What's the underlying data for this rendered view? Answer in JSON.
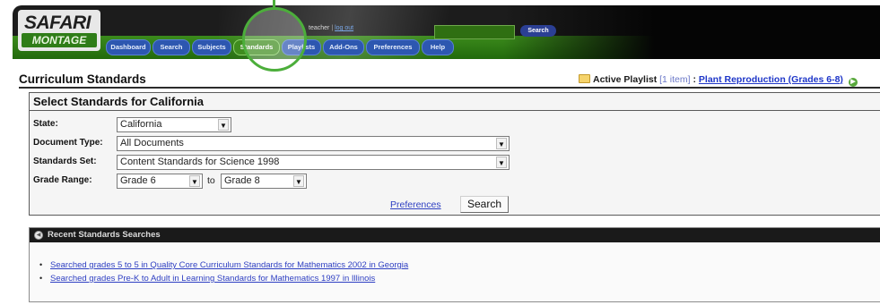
{
  "logo": {
    "top": "SAFARI",
    "bottom": "MONTAGE"
  },
  "header": {
    "teacher_text": "teacher",
    "separator": "|",
    "logout": "log out",
    "search_placeholder": "",
    "search_button": "Search"
  },
  "nav": [
    {
      "label": "Dashboard"
    },
    {
      "label": "Search"
    },
    {
      "label": "Subjects"
    },
    {
      "label": "Standards"
    },
    {
      "label": "Playlists"
    },
    {
      "label": "Add-Ons"
    },
    {
      "label": "Preferences"
    },
    {
      "label": "Help"
    }
  ],
  "page": {
    "title": "Curriculum Standards"
  },
  "playlist": {
    "label": "Active Playlist",
    "count": "[1 item]",
    "sep": ":",
    "link": "Plant Reproduction (Grades 6-8)"
  },
  "form": {
    "title": "Select Standards for California",
    "state_label": "State:",
    "state_value": "California",
    "doctype_label": "Document Type:",
    "doctype_value": "All Documents",
    "set_label": "Standards Set:",
    "set_value": "Content Standards for Science 1998",
    "grade_label": "Grade Range:",
    "grade_from": "Grade 6",
    "to_text": "to",
    "grade_to": "Grade 8",
    "preferences_link": "Preferences",
    "search_button": "Search"
  },
  "recent": {
    "title": "Recent Standards Searches",
    "items": [
      {
        "text": "Searched grades 5 to 5 in Quality Core Curriculum Standards for Mathematics 2002 in Georgia"
      },
      {
        "text": "Searched grades Pre-K to Adult in Learning Standards for Mathematics 1997 in Illinois"
      }
    ]
  },
  "colors": {
    "accent_green": "#3f8c1f",
    "nav_blue": "#2d57b0",
    "link_blue": "#2e3fc2"
  },
  "icons": {
    "folder": "folder-icon",
    "go": "play-circle-icon",
    "recent": "history-icon",
    "dropdown": "chevron-down-icon"
  }
}
